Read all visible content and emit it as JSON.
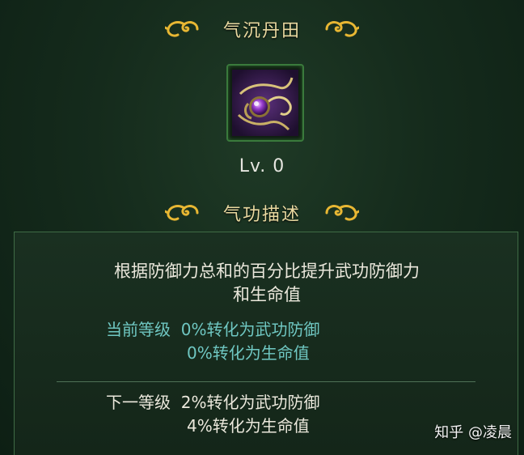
{
  "header": {
    "title": "气沉丹田"
  },
  "skill": {
    "level": "Lv. 0"
  },
  "section": {
    "title": "气功描述"
  },
  "description": {
    "line1": "根据防御力总和的百分比提升武功防御力",
    "line2": "和生命值"
  },
  "current": {
    "label": "当前等级",
    "effect1": "0%转化为武功防御",
    "effect2": "0%转化为生命值"
  },
  "next": {
    "label": "下一等级",
    "effect1": "2%转化为武功防御",
    "effect2": "4%转化为生命值"
  },
  "watermark": "知乎 @凌晨",
  "colors": {
    "background": "#152b1c",
    "title_gold": "#e9d9a0",
    "current_cyan": "#6fc7c2",
    "panel_border": "#3f6b45"
  },
  "icons": [
    "cloud-ornament-icon",
    "skill-icon"
  ]
}
